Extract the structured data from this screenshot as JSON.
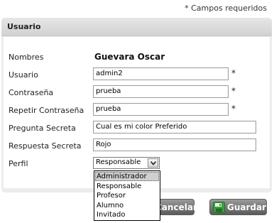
{
  "required_note": "* Campos requeridos",
  "section": {
    "title": "Usuario"
  },
  "form": {
    "nombres": {
      "label": "Nombres",
      "value": "Guevara Oscar"
    },
    "usuario": {
      "label": "Usuario",
      "value": "admin2",
      "required": "*"
    },
    "contrasena": {
      "label": "Contraseña",
      "value": "prueba",
      "required": "*"
    },
    "repetir": {
      "label": "Repetir Contraseña",
      "value": "prueba",
      "required": "*"
    },
    "pregunta": {
      "label": "Pregunta Secreta",
      "value": "Cual es mi color Preferido"
    },
    "respuesta": {
      "label": "Respuesta Secreta",
      "value": "Rojo"
    },
    "perfil": {
      "label": "Perfil",
      "selected": "Responsable",
      "options": [
        "Administrador",
        "Responsable",
        "Profesor",
        "Alumno",
        "Invitado"
      ],
      "highlighted": "Administrador"
    }
  },
  "buttons": {
    "cancel": {
      "label": "Cancelar",
      "icon": "cancel-icon"
    },
    "save": {
      "label": "Guardar",
      "icon": "save-icon"
    }
  },
  "colors": {
    "header_bg": "#d9d9d9",
    "button_bg": "#707070",
    "save_icon": "#3aa040"
  }
}
